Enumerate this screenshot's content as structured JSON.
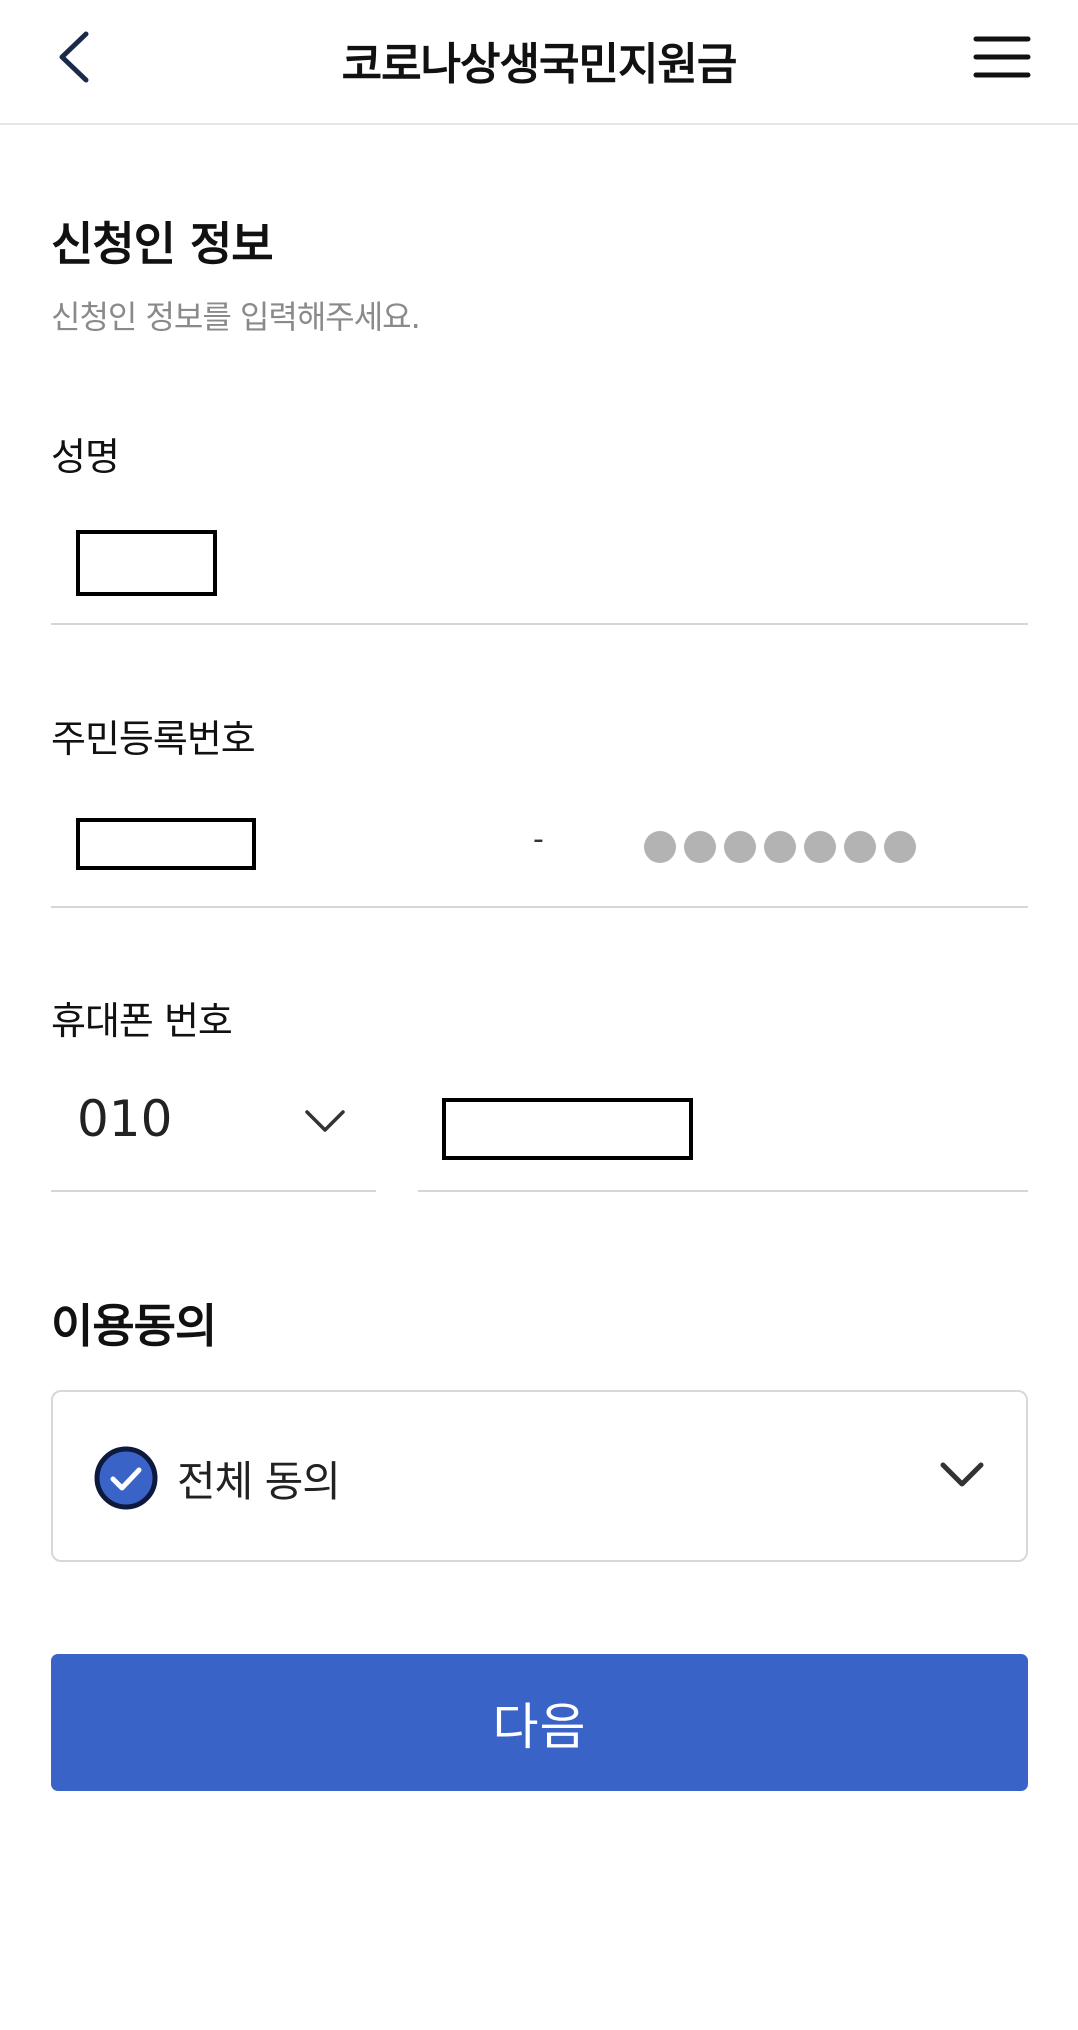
{
  "header": {
    "title": "코로나상생국민지원금"
  },
  "applicant": {
    "section_title": "신청인 정보",
    "section_desc": "신청인 정보를 입력해주세요.",
    "name_label": "성명",
    "rrn_label": "주민등록번호",
    "rrn_separator": "-",
    "rrn_masked_digit_count": 7,
    "phone_label": "휴대폰 번호",
    "phone_prefix": "010"
  },
  "consent": {
    "section_title": "이용동의",
    "agree_all_label": "전체 동의",
    "agree_all_checked": true
  },
  "actions": {
    "next_label": "다음"
  },
  "colors": {
    "primary": "#3a63c8",
    "check_fill": "#3a63c8",
    "check_border": "#0d1a3d",
    "mask_dot": "#b3b3b3"
  },
  "icons": {
    "back": "chevron-left-icon",
    "menu": "hamburger-menu-icon",
    "dropdown": "chevron-down-icon",
    "check": "check-circle-icon"
  }
}
